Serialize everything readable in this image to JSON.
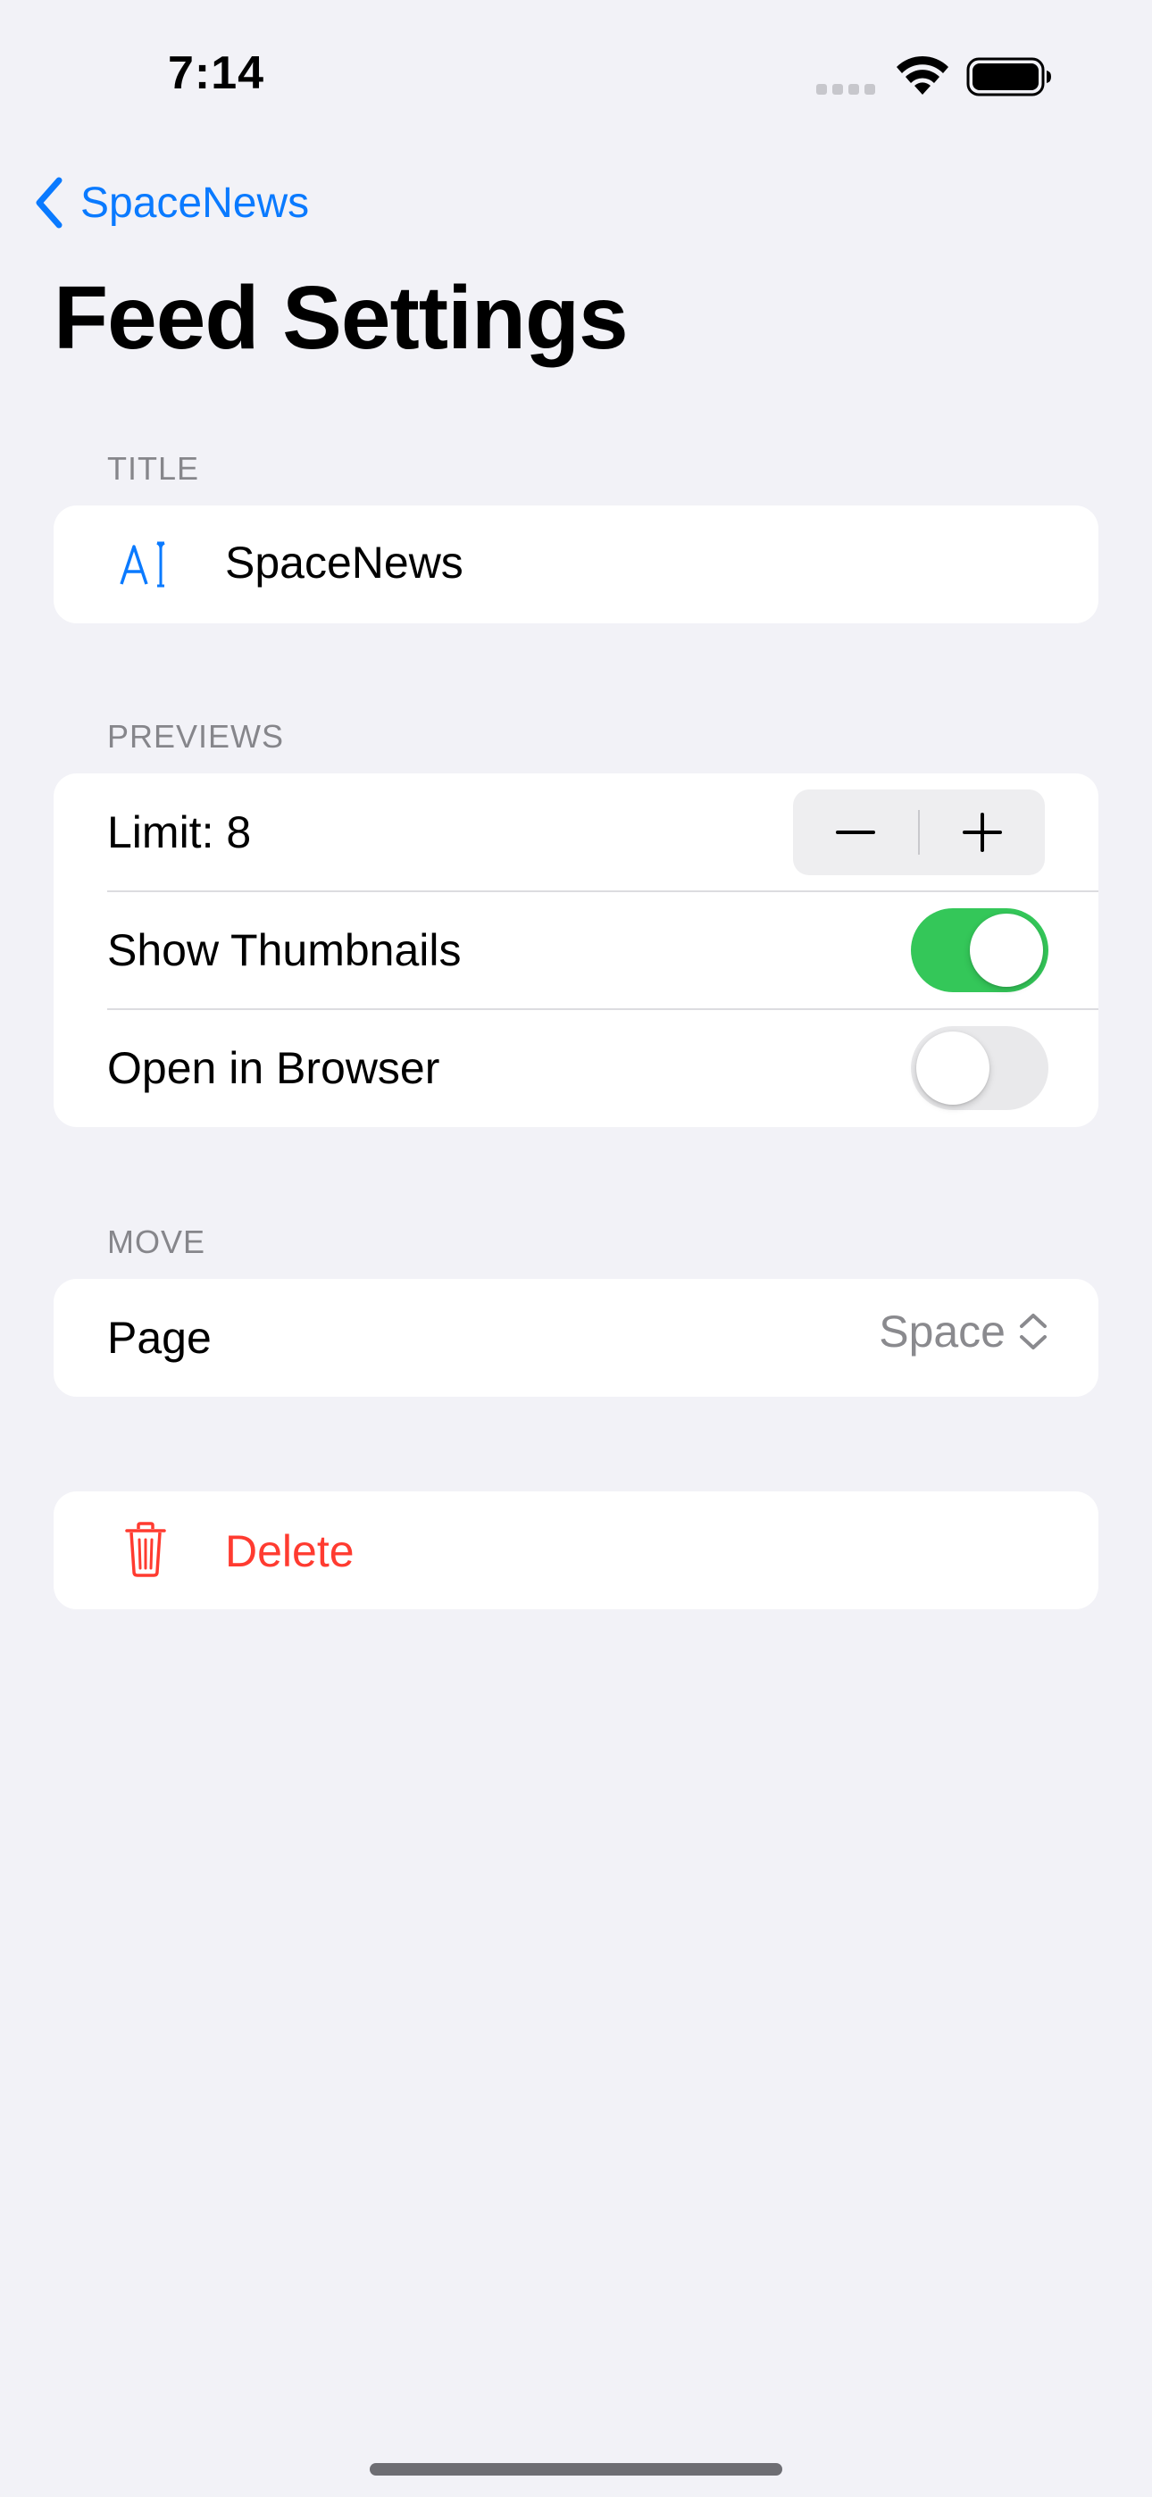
{
  "status_bar": {
    "time": "7:14"
  },
  "nav": {
    "back_label": "SpaceNews",
    "title": "Feed Settings"
  },
  "sections": {
    "title": {
      "header": "TITLE",
      "field_value": "SpaceNews",
      "icon": "text-cursor-icon"
    },
    "previews": {
      "header": "PREVIEWS",
      "limit_label": "Limit: 8",
      "limit_value": 8,
      "show_thumbnails_label": "Show Thumbnails",
      "show_thumbnails_on": true,
      "open_in_browser_label": "Open in Browser",
      "open_in_browser_on": false
    },
    "move": {
      "header": "MOVE",
      "page_label": "Page",
      "page_value": "Space"
    },
    "delete": {
      "label": "Delete",
      "icon": "trash-icon"
    }
  },
  "colors": {
    "accent": "#0a7aff",
    "toggle_on": "#34c759",
    "destructive": "#ff3b30",
    "background": "#f2f2f7"
  }
}
